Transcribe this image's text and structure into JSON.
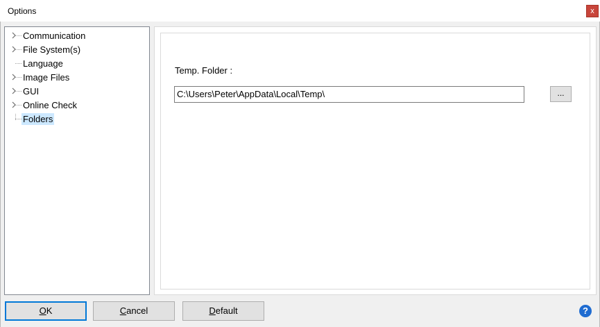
{
  "window": {
    "title": "Options",
    "close_glyph": "x"
  },
  "tree": {
    "items": [
      {
        "label": "Communication",
        "expandable": true
      },
      {
        "label": "File System(s)",
        "expandable": true
      },
      {
        "label": "Language",
        "expandable": false
      },
      {
        "label": "Image Files",
        "expandable": true
      },
      {
        "label": "GUI",
        "expandable": true
      },
      {
        "label": "Online Check",
        "expandable": true
      },
      {
        "label": "Folders",
        "expandable": false,
        "selected": true
      }
    ]
  },
  "panel": {
    "temp_folder_label": "Temp. Folder :",
    "temp_folder_value": "C:\\Users\\Peter\\AppData\\Local\\Temp\\",
    "browse_label": "..."
  },
  "buttons": {
    "ok": {
      "prefix": "",
      "accel": "O",
      "rest": "K"
    },
    "cancel": {
      "prefix": "",
      "accel": "C",
      "rest": "ancel"
    },
    "default": {
      "prefix": "",
      "accel": "D",
      "rest": "efault"
    }
  },
  "help": {
    "glyph": "?"
  },
  "colors": {
    "accent": "#0078d7",
    "selection": "#cce8ff",
    "close": "#c8453b",
    "help": "#1f6cd1"
  }
}
